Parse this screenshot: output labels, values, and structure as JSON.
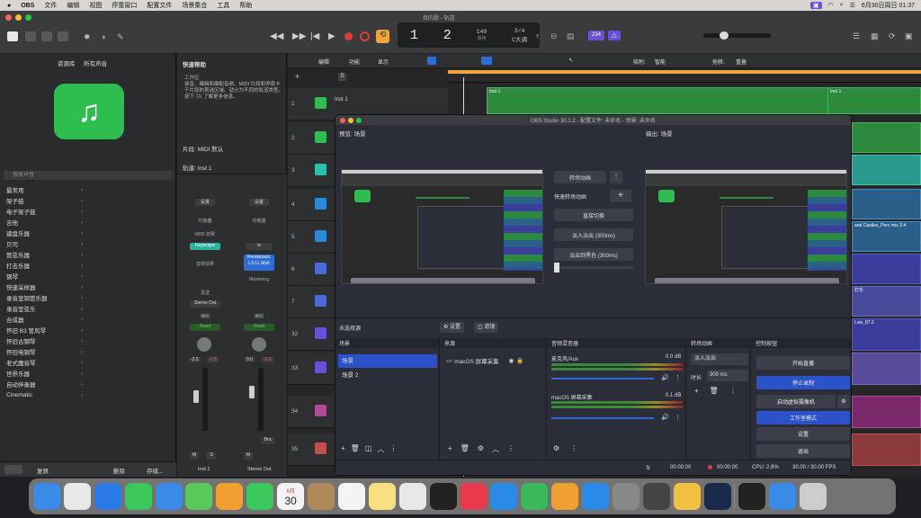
{
  "menubar": {
    "app": "OBS",
    "items": [
      "文件",
      "编辑",
      "视图",
      "停靠窗口",
      "配置文件",
      "场景集合",
      "工具",
      "帮助"
    ],
    "clock": "6月30日周日 01:37"
  },
  "logic": {
    "window_title": "我的歌 - 轨道",
    "lcd": {
      "bar": "1",
      "beat": "2",
      "tempo": "140",
      "tempo_label": "保持",
      "sig": "3/4",
      "key": "C大调"
    },
    "counter": "234",
    "library": {
      "title": "资源库",
      "filter": "所有声音",
      "search_placeholder": "搜索声音",
      "items": [
        "最常用",
        "架子鼓",
        "电子架子鼓",
        "吉他",
        "键盘乐器",
        "贝司",
        "管弦乐器",
        "打击乐器",
        "钢琴",
        "快速采样器",
        "录音室铜管乐器",
        "录音室弦乐",
        "合成器",
        "怀旧 B3 管风琴",
        "怀旧古钢琴",
        "怀旧电钢琴",
        "老式魔音琴",
        "世界乐器",
        "自动伴奏器",
        "Cinematic"
      ],
      "footer": {
        "revert": "复原",
        "delete": "删除",
        "save": "存储..."
      }
    },
    "quickhelp": {
      "title": "快速帮助",
      "body": "工作区\n录音、编辑和编配音频、MIDI 片段和停靠卡于片段的首选区域。就分为不同的轨道类型。\n按下 ⌘/ 了解更多信息。",
      "region_label": "片段: MIDI 默认",
      "track_label": "轨道: Inst 1"
    },
    "inspector": {
      "setting1": "设置",
      "setting2": "设置",
      "eq": "均衡器",
      "midi": "MIDI 效果",
      "keyscape": "Keyscape",
      "renaissance": "Renaissanc L3-LL Mult",
      "mastering": "Mastering",
      "audio_fx": "音频效果",
      "send": "发送",
      "stereo_out": "Stereo Out",
      "group": "编组",
      "read": "Read",
      "vol1": "-2.5",
      "pan1": "-7.8",
      "vol2": "0.0",
      "pan2": "-2.9",
      "bnc": "Bnc",
      "ch1": "Inst 1",
      "ch2": "Stereo Out"
    },
    "tracks_toolbar": {
      "edit": "编辑",
      "functions": "功能",
      "view": "显示",
      "snap_label": "吸附:",
      "snap": "智能",
      "drag_label": "拖移:",
      "drag": "重叠"
    },
    "track_numbers": [
      "1",
      "2",
      "3",
      "4",
      "5",
      "6",
      "7",
      "32",
      "33",
      "34",
      "35"
    ],
    "track_name": "Inst 1",
    "region_labels": {
      "r1": "Inst 1",
      "r2": "Inst 1",
      "r3": "and Castles_Perc mix 3-4",
      "r4": "Low_87.2",
      "r5": "打乐"
    }
  },
  "obs": {
    "title": "OBS Studio 30.1.2 - 配置文件: 未命名 - 场景: 未命名",
    "preview_label": "预览: 场景",
    "program_label": "输出: 场景",
    "transition": {
      "quick": "快速转场动画",
      "switch": "转场动画",
      "cut": "直接切换",
      "fade": "淡入淡出 (300ms)",
      "fade_black": "淡出到黑色 (300ms)"
    },
    "no_source": "未选择源",
    "props": "设置",
    "filters": "滤镜",
    "docks": {
      "scenes": "场景",
      "sources": "来源",
      "mixer": "音频混音器",
      "transitions": "转场动画",
      "controls": "控制按钮"
    },
    "scenes": [
      "场景",
      "场景 2"
    ],
    "sources": [
      "macOS 屏幕采集"
    ],
    "mixer": [
      {
        "name": "麦克风/Aux",
        "db": "0.0 dB",
        "level": 0.8
      },
      {
        "name": "macOS 屏幕采集",
        "db": "0.1 dB",
        "level": 0.8
      }
    ],
    "transition_dock": {
      "type": "淡入淡出",
      "duration_label": "时长",
      "duration": "300 ms"
    },
    "controls": {
      "stream": "开始直播",
      "record": "停止录制",
      "vcam": "启动虚拟摄像机",
      "studio": "工作室模式",
      "settings": "设置",
      "exit": "退出"
    },
    "status": {
      "t1": "00:00:00",
      "t2": "00:00:00",
      "cpu": "CPU: 2.8%",
      "fps": "30.00 / 30.00 FPS"
    }
  },
  "dock": {
    "calendar_month": "6月",
    "calendar_day": "30"
  },
  "colors": {
    "obs_blue": "#2c52c9",
    "logic_green": "#2c8a3e",
    "logic_yellow": "#f0a53a",
    "record_red": "#e03a3a"
  }
}
